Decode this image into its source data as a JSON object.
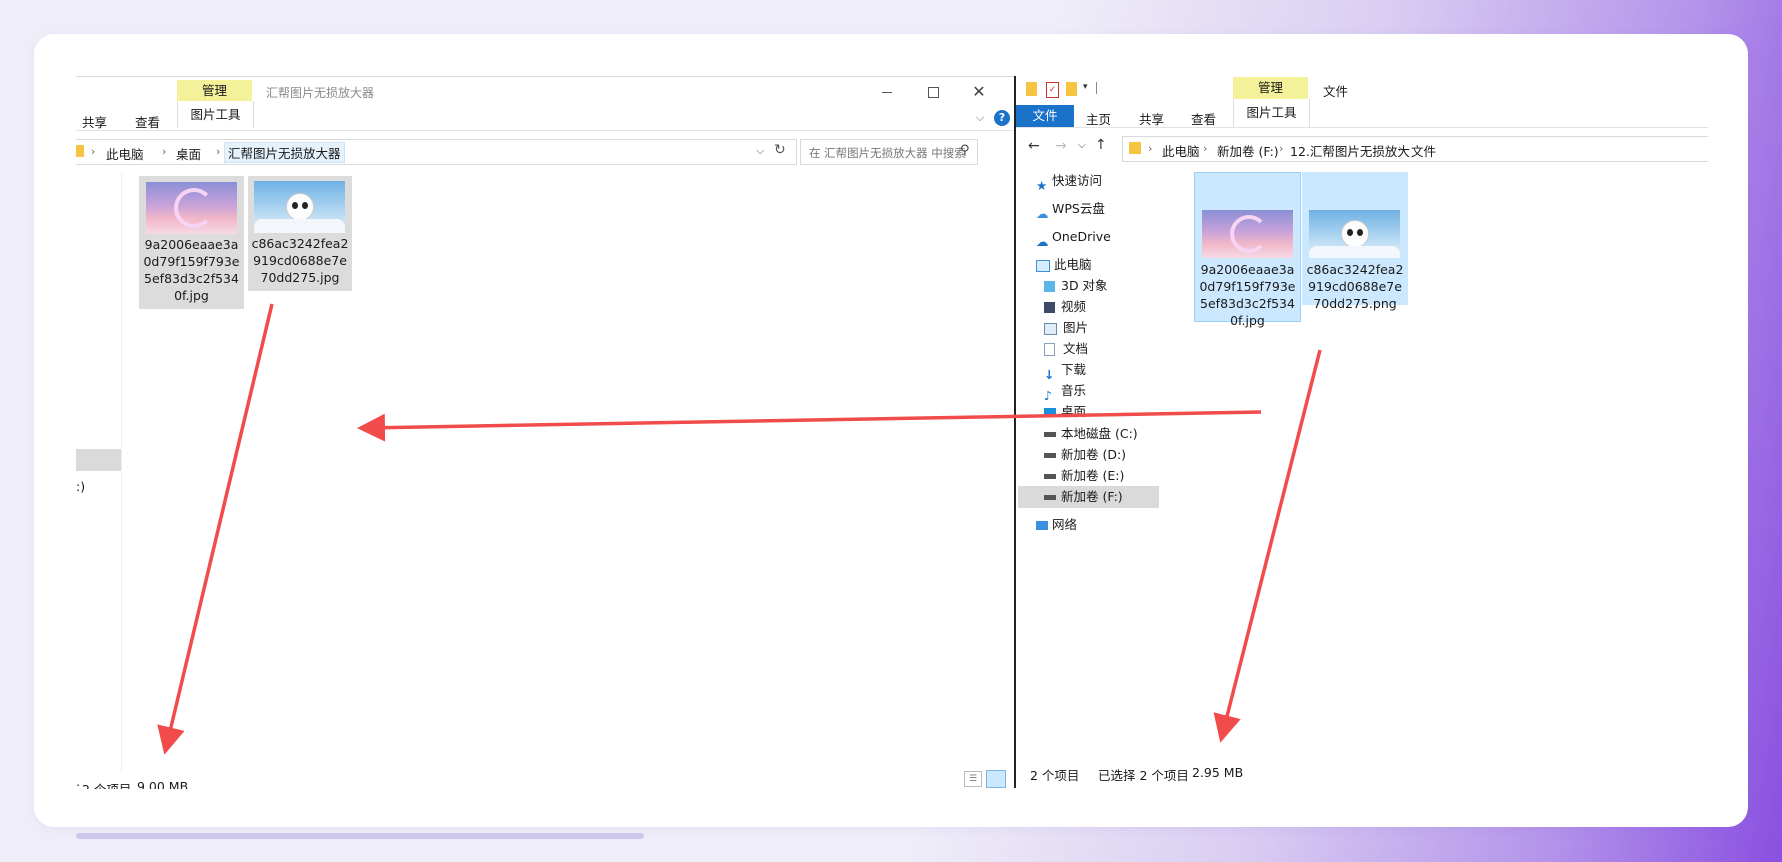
{
  "left_window": {
    "title": "汇帮图片无损放大器",
    "context_tab": "管理",
    "ribbon_tabs": [
      "共享",
      "查看",
      "图片工具"
    ],
    "breadcrumb": [
      "此电脑",
      "桌面",
      "汇帮图片无损放大器"
    ],
    "search_placeholder": "在 汇帮图片无损放大器 中搜索",
    "nav_partial_label": ":)",
    "files": [
      {
        "name": "9a2006eaae3a0d79f159f793e5ef83d3c2f5340f.jpg",
        "thumb": "dreamy-moon-clouds"
      },
      {
        "name": "c86ac3242fea2919cd0688e7e70dd275.jpg",
        "thumb": "panda-on-clouds"
      }
    ],
    "status_count": "2 个项目",
    "status_size": "9.00 MB",
    "status_prefix": ":"
  },
  "right_window": {
    "quick_toolbar_icons": [
      "folder-icon",
      "properties-icon",
      "new-folder-icon",
      "customize-icon"
    ],
    "context_tab": "管理",
    "title": "文件",
    "ribbon_tabs": [
      "文件",
      "主页",
      "共享",
      "查看",
      "图片工具"
    ],
    "breadcrumb": [
      "此电脑",
      "新加卷 (F:)",
      "12.汇帮图片无损放大",
      "文件"
    ],
    "nav": {
      "quick_access": "快速访问",
      "wps": "WPS云盘",
      "onedrive": "OneDrive",
      "this_pc": "此电脑",
      "children": [
        "3D 对象",
        "视频",
        "图片",
        "文档",
        "下载",
        "音乐",
        "桌面",
        "本地磁盘 (C:)",
        "新加卷 (D:)",
        "新加卷 (E:)",
        "新加卷 (F:)"
      ],
      "network": "网络"
    },
    "files": [
      {
        "name": "9a2006eaae3a0d79f159f793e5ef83d3c2f5340f.jpg",
        "thumb": "dreamy-moon-clouds"
      },
      {
        "name": "c86ac3242fea2919cd0688e7e70dd275.png",
        "thumb": "panda-on-clouds"
      }
    ],
    "status_count": "2 个项目",
    "status_selected": "已选择 2 个项目",
    "status_size": "2.95 MB"
  },
  "colors": {
    "accent": "#1a73c8",
    "selection": "#cce8ff",
    "context_tab": "#f3f19a",
    "arrow": "#f24b4b"
  }
}
